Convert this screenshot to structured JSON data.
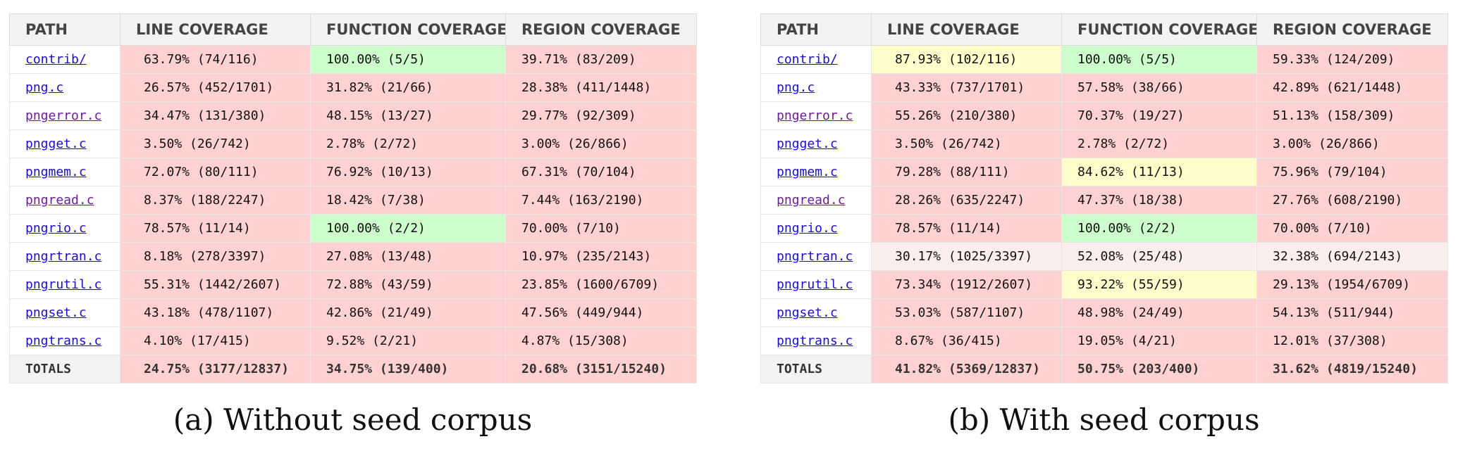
{
  "headers": [
    "PATH",
    "LINE COVERAGE",
    "FUNCTION COVERAGE",
    "REGION COVERAGE"
  ],
  "colors": {
    "red": "#ffd1d1",
    "green": "#ccffcc",
    "yellow": "#ffffcc",
    "pink": "#fdeeee",
    "link": "#1a0dcc",
    "visited_link": "#6a1b9a",
    "header_bg": "#f3f3f3"
  },
  "panel_a": {
    "caption": "(a) Without seed corpus",
    "rows": [
      {
        "path": "contrib/",
        "visited": false,
        "line": "63.79% (74/116)",
        "line_c": "red",
        "func": "100.00% (5/5)",
        "func_c": "green",
        "region": "39.71% (83/209)",
        "region_c": "red"
      },
      {
        "path": "png.c",
        "visited": false,
        "line": "26.57% (452/1701)",
        "line_c": "red",
        "func": "31.82% (21/66)",
        "func_c": "red",
        "region": "28.38% (411/1448)",
        "region_c": "red"
      },
      {
        "path": "pngerror.c",
        "visited": true,
        "line": "34.47% (131/380)",
        "line_c": "red",
        "func": "48.15% (13/27)",
        "func_c": "red",
        "region": "29.77% (92/309)",
        "region_c": "red"
      },
      {
        "path": "pngget.c",
        "visited": false,
        "line": "3.50% (26/742)",
        "line_c": "red",
        "func": "2.78% (2/72)",
        "func_c": "red",
        "region": "3.00% (26/866)",
        "region_c": "red"
      },
      {
        "path": "pngmem.c",
        "visited": false,
        "line": "72.07% (80/111)",
        "line_c": "red",
        "func": "76.92% (10/13)",
        "func_c": "red",
        "region": "67.31% (70/104)",
        "region_c": "red"
      },
      {
        "path": "pngread.c",
        "visited": true,
        "line": "8.37% (188/2247)",
        "line_c": "red",
        "func": "18.42% (7/38)",
        "func_c": "red",
        "region": "7.44% (163/2190)",
        "region_c": "red"
      },
      {
        "path": "pngrio.c",
        "visited": false,
        "line": "78.57% (11/14)",
        "line_c": "red",
        "func": "100.00% (2/2)",
        "func_c": "green",
        "region": "70.00% (7/10)",
        "region_c": "red"
      },
      {
        "path": "pngrtran.c",
        "visited": false,
        "line": "8.18% (278/3397)",
        "line_c": "red",
        "func": "27.08% (13/48)",
        "func_c": "red",
        "region": "10.97% (235/2143)",
        "region_c": "red"
      },
      {
        "path": "pngrutil.c",
        "visited": false,
        "line": "55.31% (1442/2607)",
        "line_c": "red",
        "func": "72.88% (43/59)",
        "func_c": "red",
        "region": "23.85% (1600/6709)",
        "region_c": "red"
      },
      {
        "path": "pngset.c",
        "visited": false,
        "line": "43.18% (478/1107)",
        "line_c": "red",
        "func": "42.86% (21/49)",
        "func_c": "red",
        "region": "47.56% (449/944)",
        "region_c": "red"
      },
      {
        "path": "pngtrans.c",
        "visited": false,
        "line": "4.10% (17/415)",
        "line_c": "red",
        "func": "9.52% (2/21)",
        "func_c": "red",
        "region": "4.87% (15/308)",
        "region_c": "red"
      }
    ],
    "totals": {
      "label": "TOTALS",
      "line": "24.75% (3177/12837)",
      "line_c": "red",
      "func": "34.75% (139/400)",
      "func_c": "red",
      "region": "20.68% (3151/15240)",
      "region_c": "red"
    }
  },
  "panel_b": {
    "caption": "(b) With seed corpus",
    "rows": [
      {
        "path": "contrib/",
        "visited": false,
        "line": "87.93% (102/116)",
        "line_c": "yellow",
        "func": "100.00% (5/5)",
        "func_c": "green",
        "region": "59.33% (124/209)",
        "region_c": "red"
      },
      {
        "path": "png.c",
        "visited": false,
        "line": "43.33% (737/1701)",
        "line_c": "red",
        "func": "57.58% (38/66)",
        "func_c": "red",
        "region": "42.89% (621/1448)",
        "region_c": "red"
      },
      {
        "path": "pngerror.c",
        "visited": true,
        "line": "55.26% (210/380)",
        "line_c": "red",
        "func": "70.37% (19/27)",
        "func_c": "red",
        "region": "51.13% (158/309)",
        "region_c": "red"
      },
      {
        "path": "pngget.c",
        "visited": false,
        "line": "3.50% (26/742)",
        "line_c": "red",
        "func": "2.78% (2/72)",
        "func_c": "red",
        "region": "3.00% (26/866)",
        "region_c": "red"
      },
      {
        "path": "pngmem.c",
        "visited": false,
        "line": "79.28% (88/111)",
        "line_c": "red",
        "func": "84.62% (11/13)",
        "func_c": "yellow",
        "region": "75.96% (79/104)",
        "region_c": "red"
      },
      {
        "path": "pngread.c",
        "visited": true,
        "line": "28.26% (635/2247)",
        "line_c": "red",
        "func": "47.37% (18/38)",
        "func_c": "red",
        "region": "27.76% (608/2190)",
        "region_c": "red"
      },
      {
        "path": "pngrio.c",
        "visited": false,
        "line": "78.57% (11/14)",
        "line_c": "red",
        "func": "100.00% (2/2)",
        "func_c": "green",
        "region": "70.00% (7/10)",
        "region_c": "red"
      },
      {
        "path": "pngrtran.c",
        "visited": false,
        "line": "30.17% (1025/3397)",
        "line_c": "pink",
        "func": "52.08% (25/48)",
        "func_c": "pink",
        "region": "32.38% (694/2143)",
        "region_c": "pink",
        "hover": true
      },
      {
        "path": "pngrutil.c",
        "visited": false,
        "line": "73.34% (1912/2607)",
        "line_c": "red",
        "func": "93.22% (55/59)",
        "func_c": "yellow",
        "region": "29.13% (1954/6709)",
        "region_c": "red"
      },
      {
        "path": "pngset.c",
        "visited": false,
        "line": "53.03% (587/1107)",
        "line_c": "red",
        "func": "48.98% (24/49)",
        "func_c": "red",
        "region": "54.13% (511/944)",
        "region_c": "red"
      },
      {
        "path": "pngtrans.c",
        "visited": false,
        "line": "8.67% (36/415)",
        "line_c": "red",
        "func": "19.05% (4/21)",
        "func_c": "red",
        "region": "12.01% (37/308)",
        "region_c": "red"
      }
    ],
    "totals": {
      "label": "TOTALS",
      "line": "41.82% (5369/12837)",
      "line_c": "red",
      "func": "50.75% (203/400)",
      "func_c": "red",
      "region": "31.62% (4819/15240)",
      "region_c": "red"
    }
  }
}
